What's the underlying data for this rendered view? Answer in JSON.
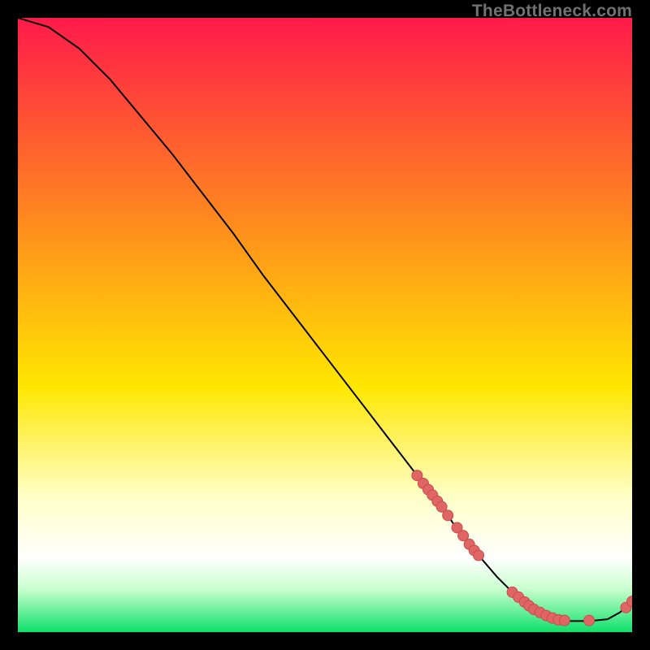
{
  "watermark": "TheBottleneck.com",
  "chart_data": {
    "type": "line",
    "title": "",
    "xlabel": "",
    "ylabel": "",
    "xlim": [
      0,
      100
    ],
    "ylim": [
      0,
      100
    ],
    "curve": {
      "x": [
        0,
        5,
        10,
        15,
        20,
        25,
        30,
        35,
        40,
        45,
        50,
        55,
        60,
        65,
        70,
        72,
        75,
        78,
        80,
        82,
        85,
        88,
        90,
        93,
        96,
        98,
        100
      ],
      "y": [
        100,
        98.5,
        95,
        90,
        84,
        78,
        71.5,
        65,
        58,
        51.5,
        45,
        38.5,
        32,
        25.5,
        19,
        16,
        12.5,
        9,
        7,
        5.2,
        3.2,
        2,
        1.8,
        1.8,
        2.1,
        3.2,
        5
      ]
    },
    "markers": [
      {
        "x": 65.0,
        "y": 25.5
      },
      {
        "x": 66.0,
        "y": 24.2
      },
      {
        "x": 66.8,
        "y": 23.2
      },
      {
        "x": 67.5,
        "y": 22.3
      },
      {
        "x": 68.3,
        "y": 21.3
      },
      {
        "x": 69.0,
        "y": 20.4
      },
      {
        "x": 70.0,
        "y": 19.0
      },
      {
        "x": 71.5,
        "y": 17.0
      },
      {
        "x": 72.5,
        "y": 15.7
      },
      {
        "x": 73.5,
        "y": 14.3
      },
      {
        "x": 74.3,
        "y": 13.3
      },
      {
        "x": 75.0,
        "y": 12.5
      },
      {
        "x": 80.5,
        "y": 6.5
      },
      {
        "x": 81.5,
        "y": 5.7
      },
      {
        "x": 82.5,
        "y": 4.9
      },
      {
        "x": 83.2,
        "y": 4.3
      },
      {
        "x": 84.0,
        "y": 3.7
      },
      {
        "x": 85.0,
        "y": 3.2
      },
      {
        "x": 86.0,
        "y": 2.7
      },
      {
        "x": 87.0,
        "y": 2.3
      },
      {
        "x": 88.0,
        "y": 2.0
      },
      {
        "x": 89.0,
        "y": 1.9
      },
      {
        "x": 93.0,
        "y": 1.9
      },
      {
        "x": 99.0,
        "y": 4.0
      },
      {
        "x": 100.0,
        "y": 5.0
      }
    ],
    "colors": {
      "curve": "#000000",
      "marker_fill": "#e06666",
      "marker_stroke": "#cc4a4a",
      "gradient_top": "#ff1a4a",
      "gradient_mid_upper": "#ff8a1e",
      "gradient_mid": "#ffe700",
      "gradient_pale_yellow": "#ffffc8",
      "gradient_white": "#ffffff",
      "gradient_lightgreen": "#c8ffce",
      "gradient_bottom": "#0ee06a"
    }
  }
}
